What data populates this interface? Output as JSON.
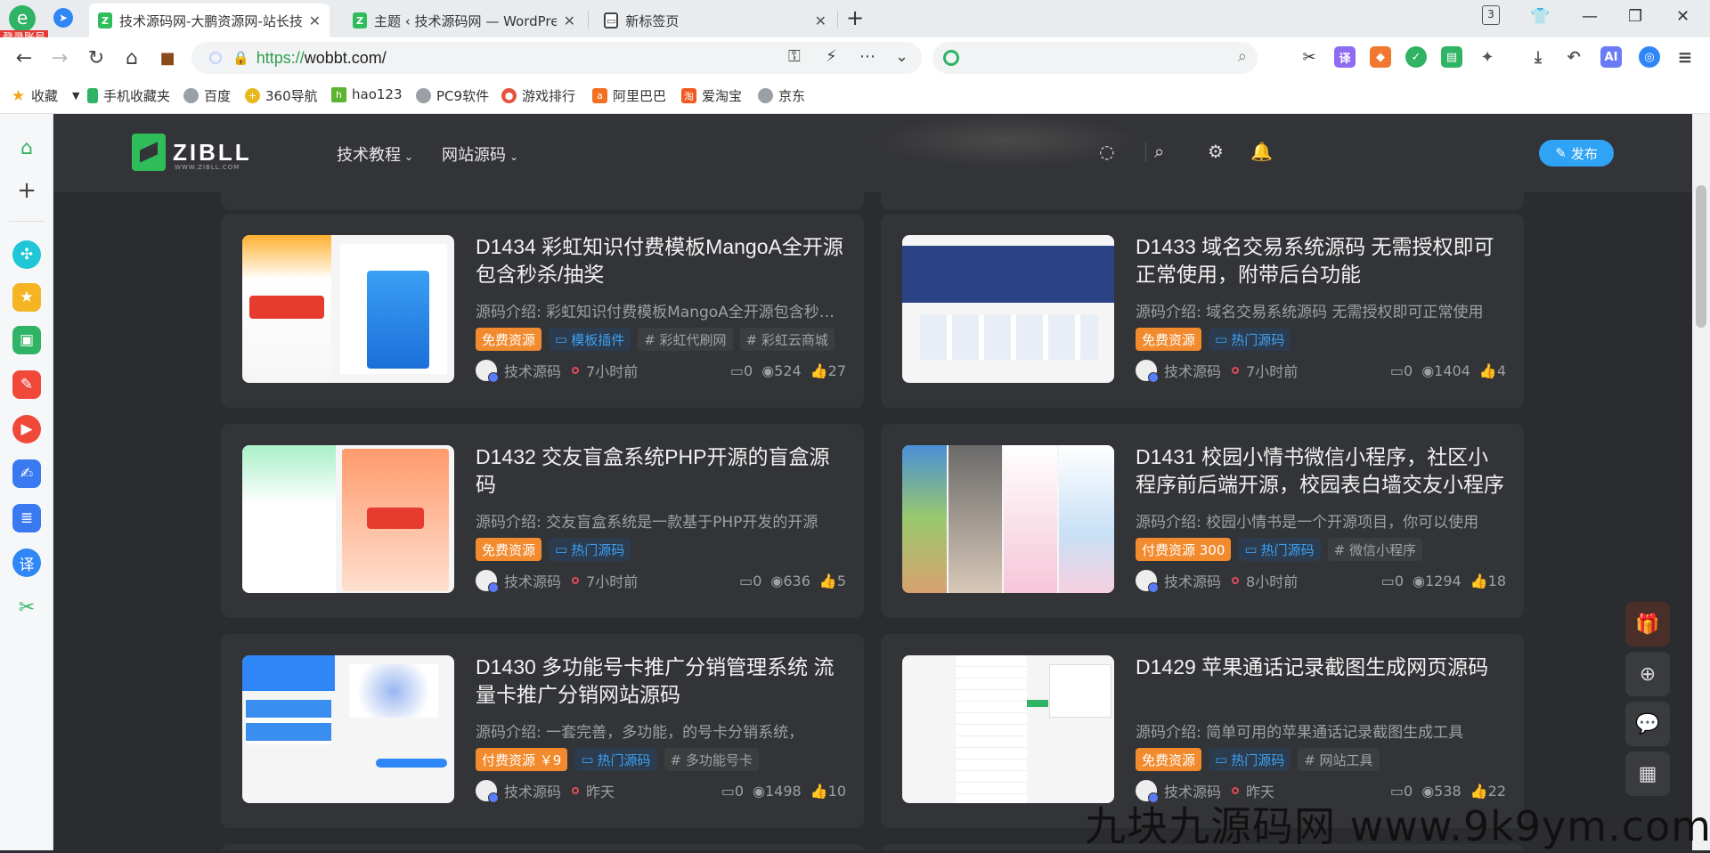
{
  "browser": {
    "login_badge": "登录账号",
    "tabs": [
      {
        "title": "技术源码网-大鹏资源网-站长技术源码",
        "active": true
      },
      {
        "title": "主题 ‹ 技术源码网 — WordPress",
        "active": false
      },
      {
        "title": "新标签页",
        "active": false
      }
    ],
    "tab_count": "3",
    "url_scheme": "https://",
    "url_host": "wobbt.com/",
    "bookmarks": [
      "收藏",
      "手机收藏夹",
      "百度",
      "360导航",
      "hao123",
      "PC9软件",
      "游戏排行",
      "阿里巴巴",
      "爱淘宝",
      "京东"
    ]
  },
  "site": {
    "logo_text": "ZIBLL",
    "logo_sub": "WWW.ZIBLL.COM",
    "nav": [
      "技术教程",
      "网站源码"
    ],
    "publish_label": "发布"
  },
  "posts": [
    {
      "title": "D1434 彩虹知识付费模板MangoA全开源包含秒杀/抽奖",
      "desc": "源码介绍:  彩虹知识付费模板MangoA全开源包含秒杀/抽奖",
      "tags": [
        {
          "type": "free",
          "text": "免费资源"
        },
        {
          "type": "cat",
          "text": "模板插件"
        },
        {
          "type": "kw",
          "text": "# 彩虹代刷网"
        },
        {
          "type": "kw",
          "text": "# 彩虹云商城"
        }
      ],
      "author": "技术源码",
      "time": "7小时前",
      "comments": "0",
      "views": "524",
      "likes": "27"
    },
    {
      "title": "D1433 域名交易系统源码 无需授权即可正常使用，附带后台功能",
      "desc": "源码介绍:  域名交易系统源码 无需授权即可正常使用",
      "tags": [
        {
          "type": "free",
          "text": "免费资源"
        },
        {
          "type": "cat",
          "text": "热门源码"
        }
      ],
      "author": "技术源码",
      "time": "7小时前",
      "comments": "0",
      "views": "1404",
      "likes": "4"
    },
    {
      "title": "D1432 交友盲盒系统PHP开源的盲盒源码",
      "desc": "源码介绍:  交友盲盒系统是一款基于PHP开发的开源",
      "tags": [
        {
          "type": "free",
          "text": "免费资源"
        },
        {
          "type": "cat",
          "text": "热门源码"
        }
      ],
      "author": "技术源码",
      "time": "7小时前",
      "comments": "0",
      "views": "636",
      "likes": "5"
    },
    {
      "title": "D1431 校园小情书微信小程序，社区小程序前后端开源，校园表白墙交友小程序",
      "desc": "源码介绍:  校园小情书是一个开源项目，你可以使用",
      "tags": [
        {
          "type": "paid",
          "text": "付费资源 300"
        },
        {
          "type": "cat",
          "text": "热门源码"
        },
        {
          "type": "kw",
          "text": "# 微信小程序"
        }
      ],
      "author": "技术源码",
      "time": "8小时前",
      "comments": "0",
      "views": "1294",
      "likes": "18"
    },
    {
      "title": "D1430 多功能号卡推广分销管理系统 流量卡推广分销网站源码",
      "desc": "源码介绍:  一套完善，多功能，的号卡分销系统，",
      "tags": [
        {
          "type": "paid",
          "text": "付费资源 ￥9"
        },
        {
          "type": "cat",
          "text": "热门源码"
        },
        {
          "type": "kw",
          "text": "# 多功能号卡"
        }
      ],
      "author": "技术源码",
      "time": "昨天",
      "comments": "0",
      "views": "1498",
      "likes": "10"
    },
    {
      "title": "D1429 苹果通话记录截图生成网页源码",
      "desc": "源码介绍:  简单可用的苹果通话记录截图生成工具",
      "tags": [
        {
          "type": "free",
          "text": "免费资源"
        },
        {
          "type": "cat",
          "text": "热门源码"
        },
        {
          "type": "kw",
          "text": "# 网站工具"
        }
      ],
      "author": "技术源码",
      "time": "昨天",
      "comments": "0",
      "views": "538",
      "likes": "22"
    }
  ],
  "watermark": "九块九源码网 www.9k9ym.com",
  "colors": {
    "accent_green": "#2ebd59",
    "tag_orange": "#f28a2e",
    "link_blue": "#2fa3f5"
  }
}
